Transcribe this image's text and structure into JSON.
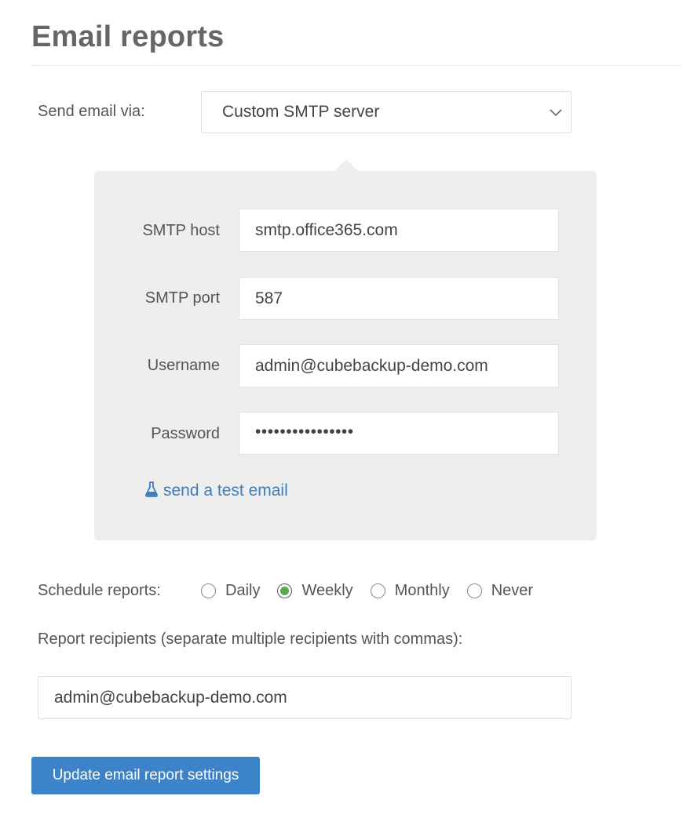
{
  "page": {
    "title": "Email reports"
  },
  "send_via": {
    "label": "Send email via:",
    "selected": "Custom SMTP server"
  },
  "smtp": {
    "host_label": "SMTP host",
    "host_value": "smtp.office365.com",
    "port_label": "SMTP port",
    "port_value": "587",
    "username_label": "Username",
    "username_value": "admin@cubebackup-demo.com",
    "password_label": "Password",
    "password_value": "••••••••••••••••",
    "test_link": "send a test email",
    "test_icon": "flask-icon"
  },
  "schedule": {
    "label": "Schedule reports:",
    "options": [
      "Daily",
      "Weekly",
      "Monthly",
      "Never"
    ],
    "selected": "Weekly"
  },
  "recipients": {
    "label": "Report recipients (separate multiple recipients with commas):",
    "value": "admin@cubebackup-demo.com"
  },
  "submit": {
    "label": "Update email report settings"
  },
  "colors": {
    "accent": "#3d83c9",
    "link": "#3a7fc1",
    "radio_checked": "#5ea84e",
    "panel_bg": "#eeeeee"
  }
}
